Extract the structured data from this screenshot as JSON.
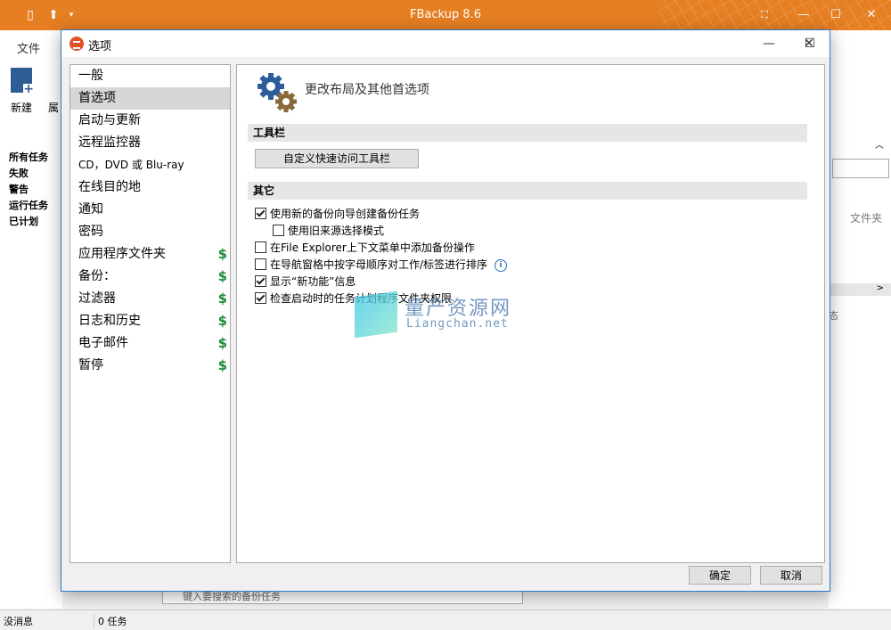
{
  "app": {
    "title": "FBackup 8.6"
  },
  "ribbon": {
    "tab_file": "文件",
    "new_label": "新建",
    "properties_partial": "属"
  },
  "left_panel": {
    "items": [
      "所有任务",
      "失败",
      "警告",
      "运行任务",
      "已计划"
    ]
  },
  "right_panel": {
    "column_partial": "文件夹",
    "status_partial": "态"
  },
  "search": {
    "placeholder": "键入要搜索的备份任务"
  },
  "statusbar": {
    "message": "没消息",
    "task_count": "0 任务"
  },
  "dialog": {
    "title": "选项",
    "nav": [
      {
        "label": "一般",
        "paid": false
      },
      {
        "label": "首选项",
        "paid": false,
        "selected": true
      },
      {
        "label": "启动与更新",
        "paid": false
      },
      {
        "label": "远程监控器",
        "paid": false
      },
      {
        "label": "CD，DVD 或 Blu-ray",
        "paid": false
      },
      {
        "label": "在线目的地",
        "paid": false
      },
      {
        "label": "通知",
        "paid": false
      },
      {
        "label": "密码",
        "paid": false
      },
      {
        "label": "应用程序文件夹",
        "paid": true
      },
      {
        "label": "备份：",
        "paid": true
      },
      {
        "label": "过滤器",
        "paid": true
      },
      {
        "label": "日志和历史",
        "paid": true
      },
      {
        "label": "电子邮件",
        "paid": true
      },
      {
        "label": "暂停",
        "paid": true
      }
    ],
    "dollar": "$",
    "heading": "更改布局及其他首选项",
    "toolbar_section": "工具栏",
    "customize_button": "自定义快速访问工具栏",
    "other_section": "其它",
    "options": [
      {
        "label": "使用新的备份向导创建备份任务",
        "checked": true
      },
      {
        "label": "使用旧来源选择模式",
        "checked": false
      },
      {
        "label": "在File Explorer上下文菜单中添加备份操作",
        "checked": false
      },
      {
        "label": "在导航窗格中按字母顺序对工作/标签进行排序",
        "checked": false
      },
      {
        "label": "显示“新功能”信息",
        "checked": true
      },
      {
        "label": "检查启动时的任务计划程序文件夹权限",
        "checked": true
      }
    ],
    "ok_button": "确定",
    "cancel_button": "取消"
  },
  "watermark": {
    "title": "量产资源网",
    "url": "Liangchan.net"
  },
  "colors": {
    "titlebar": "#e67e22",
    "dialog_border": "#2b7bd0",
    "dollar": "#1f8a3a"
  }
}
